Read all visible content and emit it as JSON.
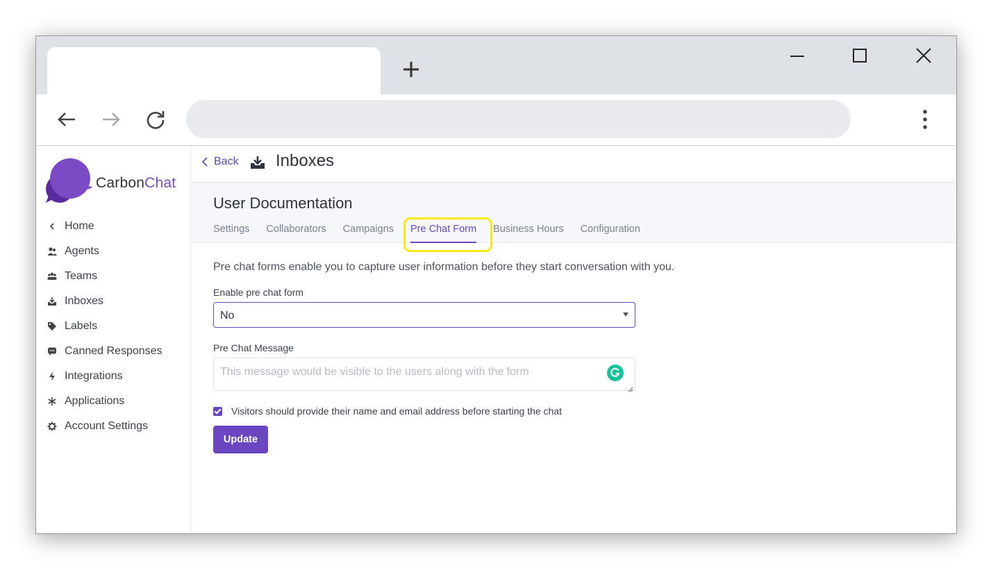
{
  "browser": {
    "tab_title": "",
    "url": "",
    "icons": [
      "new-tab-plus-icon",
      "minimize-icon",
      "maximize-icon",
      "close-icon",
      "back-arrow-icon",
      "forward-arrow-icon",
      "reload-icon",
      "kebab-menu-icon"
    ]
  },
  "brand": {
    "name_part1": "Carbon",
    "name_part2": "Chat",
    "accent_color": "#7a4bc4"
  },
  "sidebar": {
    "items": [
      {
        "label": "Home",
        "icon": "chevron-left-icon"
      },
      {
        "label": "Agents",
        "icon": "users-icon"
      },
      {
        "label": "Teams",
        "icon": "team-icon"
      },
      {
        "label": "Inboxes",
        "icon": "inbox-icon"
      },
      {
        "label": "Labels",
        "icon": "tag-icon"
      },
      {
        "label": "Canned Responses",
        "icon": "chat-bubble-icon"
      },
      {
        "label": "Integrations",
        "icon": "lightning-icon"
      },
      {
        "label": "Applications",
        "icon": "asterisk-icon"
      },
      {
        "label": "Account Settings",
        "icon": "gear-icon"
      }
    ]
  },
  "header": {
    "back_label": "Back",
    "title": "Inboxes"
  },
  "inbox": {
    "name": "User Documentation",
    "tabs": [
      {
        "label": "Settings",
        "active": false
      },
      {
        "label": "Collaborators",
        "active": false
      },
      {
        "label": "Campaigns",
        "active": false
      },
      {
        "label": "Pre Chat Form",
        "active": true
      },
      {
        "label": "Business Hours",
        "active": false
      },
      {
        "label": "Configuration",
        "active": false
      }
    ]
  },
  "form": {
    "description": "Pre chat forms enable you to capture user information before they start conversation with you.",
    "enable_label": "Enable pre chat form",
    "enable_value": "No",
    "message_label": "Pre Chat Message",
    "message_placeholder": "This message would be visible to the users along with the form",
    "checkbox_label": "Visitors should provide their name and email address before starting the chat",
    "checkbox_checked": true,
    "submit_label": "Update",
    "primary_color": "#6b46c1"
  }
}
